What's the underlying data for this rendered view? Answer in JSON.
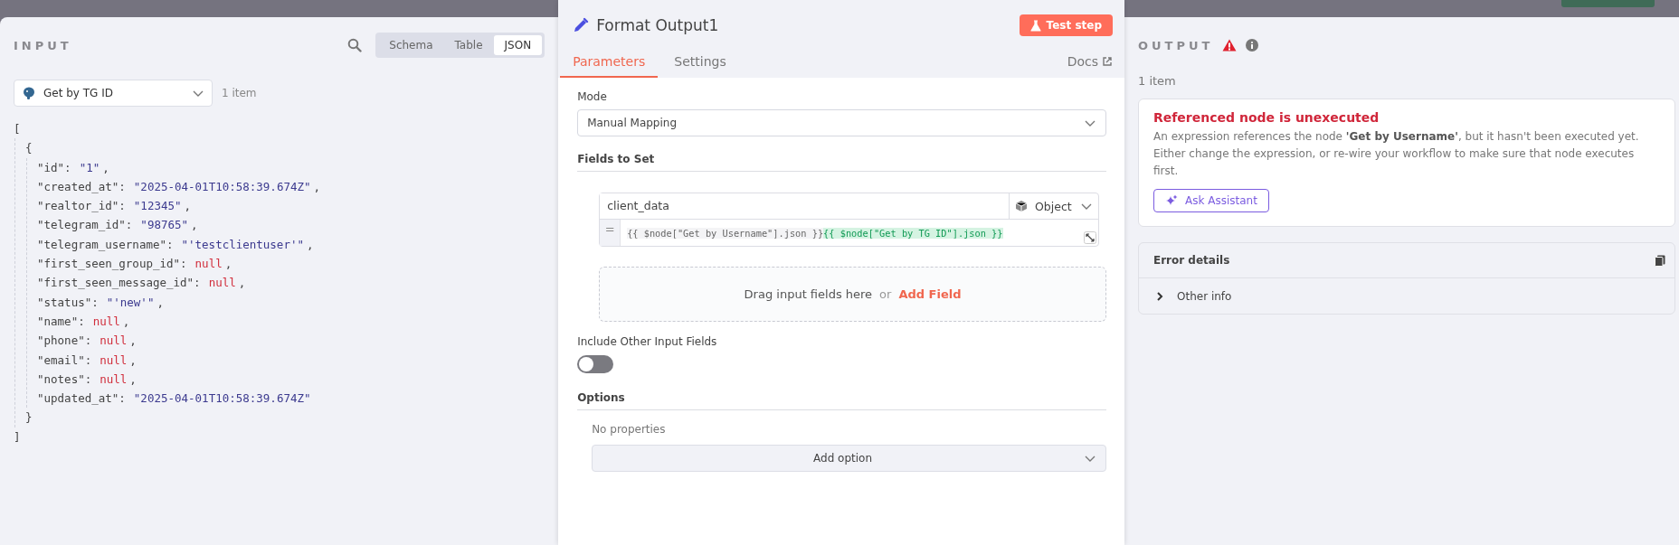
{
  "input_panel": {
    "title": "INPUT",
    "views": [
      {
        "label": "Schema",
        "selected": false
      },
      {
        "label": "Table",
        "selected": false
      },
      {
        "label": "JSON",
        "selected": true
      }
    ],
    "source_node": "Get by TG ID",
    "item_count": "1 item",
    "json": {
      "array_open": "[",
      "object_open": "{",
      "object_close": "}",
      "array_close": "]",
      "fields": [
        {
          "key": "\"id\":",
          "value": "\"1\"",
          "kind": "string",
          "sep": ","
        },
        {
          "key": "\"created_at\":",
          "value": "\"2025-04-01T10:58:39.674Z\"",
          "kind": "string",
          "sep": ","
        },
        {
          "key": "\"realtor_id\":",
          "value": "\"12345\"",
          "kind": "string",
          "sep": ","
        },
        {
          "key": "\"telegram_id\":",
          "value": "\"98765\"",
          "kind": "string",
          "sep": ","
        },
        {
          "key": "\"telegram_username\":",
          "value": "\"'testclientuser'\"",
          "kind": "string",
          "sep": ","
        },
        {
          "key": "\"first_seen_group_id\":",
          "value": "null",
          "kind": "null",
          "sep": ","
        },
        {
          "key": "\"first_seen_message_id\":",
          "value": "null",
          "kind": "null",
          "sep": ","
        },
        {
          "key": "\"status\":",
          "value": "\"'new'\"",
          "kind": "string",
          "sep": ","
        },
        {
          "key": "\"name\":",
          "value": "null",
          "kind": "null",
          "sep": ","
        },
        {
          "key": "\"phone\":",
          "value": "null",
          "kind": "null",
          "sep": ","
        },
        {
          "key": "\"email\":",
          "value": "null",
          "kind": "null",
          "sep": ","
        },
        {
          "key": "\"notes\":",
          "value": "null",
          "kind": "null",
          "sep": ","
        },
        {
          "key": "\"updated_at\":",
          "value": "\"2025-04-01T10:58:39.674Z\"",
          "kind": "string"
        }
      ]
    }
  },
  "node_panel": {
    "title": "Format Output1",
    "test_button": "Test step",
    "tabs": [
      {
        "label": "Parameters",
        "selected": true
      },
      {
        "label": "Settings",
        "selected": false
      }
    ],
    "docs_link": "Docs",
    "mode": {
      "label": "Mode",
      "value": "Manual Mapping"
    },
    "fields_to_set": {
      "label": "Fields to Set",
      "field": {
        "name": "client_data",
        "type": "Object",
        "equals": "=",
        "expression": [
          {
            "text": "{{ $node[\"Get by Username\"].json }}",
            "kind": "pending"
          },
          {
            "text": "{{ $node[\"Get by TG ID\"].json }}",
            "kind": "resolved"
          }
        ]
      },
      "drop_hint": "Drag input fields here",
      "or": "or",
      "add_field": "Add Field"
    },
    "include_other": {
      "label": "Include Other Input Fields",
      "on": false
    },
    "options": {
      "label": "Options",
      "empty": "No properties",
      "add_button": "Add option"
    }
  },
  "output_panel": {
    "title": "OUTPUT",
    "item_count": "1 item",
    "error": {
      "title": "Referenced node is unexecuted",
      "message": "An expression references the node **'Get by Username'**, but it hasn't been executed yet. Either change the expression, or re-wire your workflow to make sure that node executes first.",
      "assistant_button": "Ask Assistant"
    },
    "details": {
      "title": "Error details",
      "rows": [
        {
          "label": "Other info",
          "expanded": false
        }
      ]
    }
  }
}
